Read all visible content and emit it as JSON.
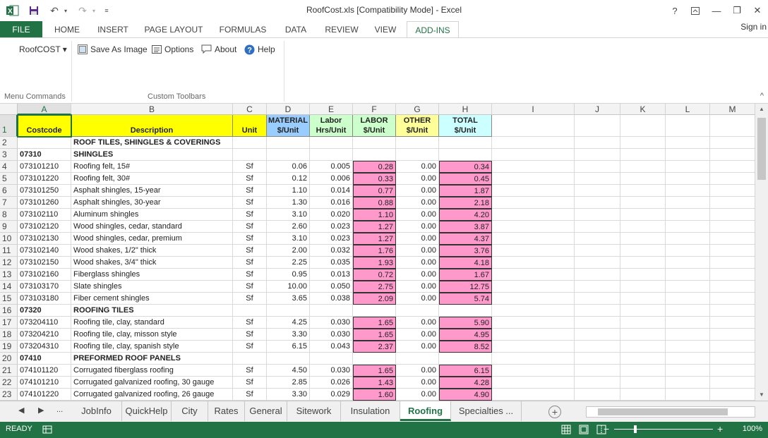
{
  "window": {
    "title": "RoofCost.xls  [Compatibility Mode] - Excel",
    "help": "?",
    "minimize": "—",
    "restore": "❐",
    "close": "✕"
  },
  "ribbon": {
    "tabs": [
      "FILE",
      "HOME",
      "INSERT",
      "PAGE LAYOUT",
      "FORMULAS",
      "DATA",
      "REVIEW",
      "VIEW",
      "ADD-INS"
    ],
    "active_tab": "ADD-INS",
    "sign_in": "Sign in",
    "menu_commands": {
      "roofcost": "RoofCOST ▾",
      "label": "Menu Commands"
    },
    "custom_toolbars": {
      "save_as_image": "Save As Image",
      "options": "Options",
      "about": "About",
      "help": "Help",
      "label": "Custom Toolbars"
    },
    "collapse": "^"
  },
  "sheet": {
    "columns": [
      "A",
      "B",
      "C",
      "D",
      "E",
      "F",
      "G",
      "H",
      "I",
      "J",
      "K",
      "L",
      "M"
    ],
    "selected_column": "A",
    "header_row": {
      "A": [
        "",
        "Costcode"
      ],
      "B": [
        "",
        "Description"
      ],
      "C": [
        "",
        "Unit"
      ],
      "D": [
        "MATERIAL",
        "$/Unit"
      ],
      "E": [
        "Labor",
        "Hrs/Unit"
      ],
      "F": [
        "LABOR",
        "$/Unit"
      ],
      "G": [
        "OTHER",
        "$/Unit"
      ],
      "H": [
        "TOTAL",
        "$/Unit"
      ]
    },
    "header_colors": {
      "A": "#ffff00",
      "B": "#ffff00",
      "C": "#ffff00",
      "D": "#99ccff",
      "E": "#ccffcc",
      "F": "#ccffcc",
      "G": "#ffff99",
      "H": "#ccffff"
    },
    "rows": [
      {
        "n": "2",
        "type": "section",
        "a": "",
        "b": "ROOF TILES, SHINGLES & COVERINGS"
      },
      {
        "n": "3",
        "type": "section",
        "a": "07310",
        "b": "SHINGLES"
      },
      {
        "n": "4",
        "type": "item",
        "a": "073101210",
        "b": "Roofing felt, 15#",
        "c": "Sf",
        "d": "0.06",
        "e": "0.005",
        "f": "0.28",
        "g": "0.00",
        "h": "0.34"
      },
      {
        "n": "5",
        "type": "item",
        "a": "073101220",
        "b": "Roofing felt, 30#",
        "c": "Sf",
        "d": "0.12",
        "e": "0.006",
        "f": "0.33",
        "g": "0.00",
        "h": "0.45"
      },
      {
        "n": "6",
        "type": "item",
        "a": "073101250",
        "b": "Asphalt shingles, 15-year",
        "c": "Sf",
        "d": "1.10",
        "e": "0.014",
        "f": "0.77",
        "g": "0.00",
        "h": "1.87"
      },
      {
        "n": "7",
        "type": "item",
        "a": "073101260",
        "b": "Asphalt shingles, 30-year",
        "c": "Sf",
        "d": "1.30",
        "e": "0.016",
        "f": "0.88",
        "g": "0.00",
        "h": "2.18"
      },
      {
        "n": "8",
        "type": "item",
        "a": "073102110",
        "b": "Aluminum shingles",
        "c": "Sf",
        "d": "3.10",
        "e": "0.020",
        "f": "1.10",
        "g": "0.00",
        "h": "4.20"
      },
      {
        "n": "9",
        "type": "item",
        "a": "073102120",
        "b": "Wood shingles, cedar, standard",
        "c": "Sf",
        "d": "2.60",
        "e": "0.023",
        "f": "1.27",
        "g": "0.00",
        "h": "3.87"
      },
      {
        "n": "10",
        "type": "item",
        "a": "073102130",
        "b": "Wood shingles, cedar, premium",
        "c": "Sf",
        "d": "3.10",
        "e": "0.023",
        "f": "1.27",
        "g": "0.00",
        "h": "4.37"
      },
      {
        "n": "11",
        "type": "item",
        "a": "073102140",
        "b": "Wood shakes, 1/2\" thick",
        "c": "Sf",
        "d": "2.00",
        "e": "0.032",
        "f": "1.76",
        "g": "0.00",
        "h": "3.76"
      },
      {
        "n": "12",
        "type": "item",
        "a": "073102150",
        "b": "Wood shakes, 3/4\" thick",
        "c": "Sf",
        "d": "2.25",
        "e": "0.035",
        "f": "1.93",
        "g": "0.00",
        "h": "4.18"
      },
      {
        "n": "13",
        "type": "item",
        "a": "073102160",
        "b": "Fiberglass shingles",
        "c": "Sf",
        "d": "0.95",
        "e": "0.013",
        "f": "0.72",
        "g": "0.00",
        "h": "1.67"
      },
      {
        "n": "14",
        "type": "item",
        "a": "073103170",
        "b": "Slate shingles",
        "c": "Sf",
        "d": "10.00",
        "e": "0.050",
        "f": "2.75",
        "g": "0.00",
        "h": "12.75"
      },
      {
        "n": "15",
        "type": "item",
        "a": "073103180",
        "b": "Fiber cement shingles",
        "c": "Sf",
        "d": "3.65",
        "e": "0.038",
        "f": "2.09",
        "g": "0.00",
        "h": "5.74"
      },
      {
        "n": "16",
        "type": "section",
        "a": "07320",
        "b": "ROOFING TILES"
      },
      {
        "n": "17",
        "type": "item",
        "a": "073204110",
        "b": "Roofing tile, clay, standard",
        "c": "Sf",
        "d": "4.25",
        "e": "0.030",
        "f": "1.65",
        "g": "0.00",
        "h": "5.90"
      },
      {
        "n": "18",
        "type": "item",
        "a": "073204210",
        "b": "Roofing tile, clay, misson style",
        "c": "Sf",
        "d": "3.30",
        "e": "0.030",
        "f": "1.65",
        "g": "0.00",
        "h": "4.95"
      },
      {
        "n": "19",
        "type": "item",
        "a": "073204310",
        "b": "Roofing tile, clay, spanish style",
        "c": "Sf",
        "d": "6.15",
        "e": "0.043",
        "f": "2.37",
        "g": "0.00",
        "h": "8.52"
      },
      {
        "n": "20",
        "type": "section",
        "a": "07410",
        "b": "PREFORMED ROOF PANELS"
      },
      {
        "n": "21",
        "type": "item",
        "a": "074101120",
        "b": "Corrugated fiberglass roofing",
        "c": "Sf",
        "d": "4.50",
        "e": "0.030",
        "f": "1.65",
        "g": "0.00",
        "h": "6.15"
      },
      {
        "n": "22",
        "type": "item",
        "a": "074101210",
        "b": "Corrugated galvanized roofing, 30 gauge",
        "c": "Sf",
        "d": "2.85",
        "e": "0.026",
        "f": "1.43",
        "g": "0.00",
        "h": "4.28"
      },
      {
        "n": "23",
        "type": "item",
        "a": "074101220",
        "b": "Corrugated galvanized roofing, 26 gauge",
        "c": "Sf",
        "d": "3.30",
        "e": "0.029",
        "f": "1.60",
        "g": "0.00",
        "h": "4.90"
      }
    ]
  },
  "sheet_tabs": {
    "nav_prev": "◀",
    "nav_next": "▶",
    "nav_more": "...",
    "tabs": [
      "JobInfo",
      "QuickHelp",
      "City",
      "Rates",
      "General",
      "Sitework",
      "Insulation",
      "Roofing",
      "Specialties ..."
    ],
    "active": "Roofing",
    "add": "+"
  },
  "status": {
    "ready": "READY",
    "zoom_minus": "−",
    "zoom_plus": "+",
    "zoom": "100%",
    "zoom_level_percent": 100
  },
  "colors": {
    "excel_green": "#217346",
    "pink_cell": "#ff99cc"
  }
}
